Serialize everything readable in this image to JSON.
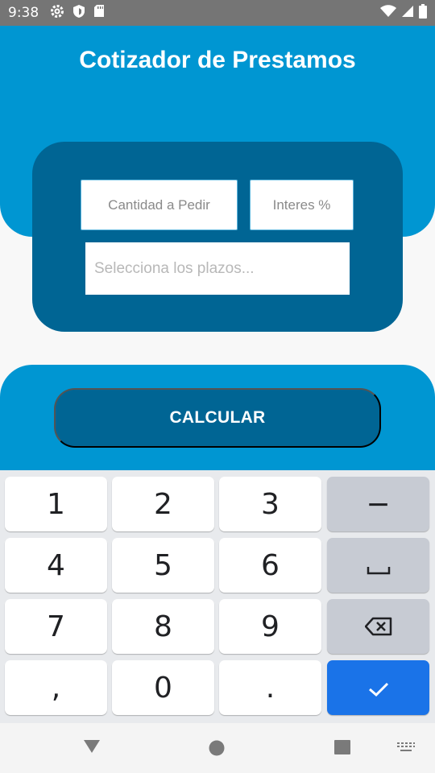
{
  "status_bar": {
    "time": "9:38",
    "icons": [
      "settings-icon",
      "shield-icon",
      "sd-card-icon"
    ],
    "right_icons": [
      "wifi-icon",
      "signal-icon",
      "battery-icon"
    ]
  },
  "app": {
    "title": "Cotizador de Prestamos"
  },
  "form": {
    "amount_placeholder": "Cantidad a Pedir",
    "interest_placeholder": "Interes %",
    "term_placeholder": "Selecciona los plazos..."
  },
  "actions": {
    "calculate_label": "CALCULAR"
  },
  "keyboard": {
    "keys": [
      "1",
      "2",
      "3",
      "−",
      "4",
      "5",
      "6",
      "␣",
      "7",
      "8",
      "9",
      "⌫",
      ",",
      "0",
      ".",
      "✓"
    ]
  },
  "colors": {
    "header": "#0096d2",
    "card": "#006594",
    "accent": "#1a73e8"
  }
}
